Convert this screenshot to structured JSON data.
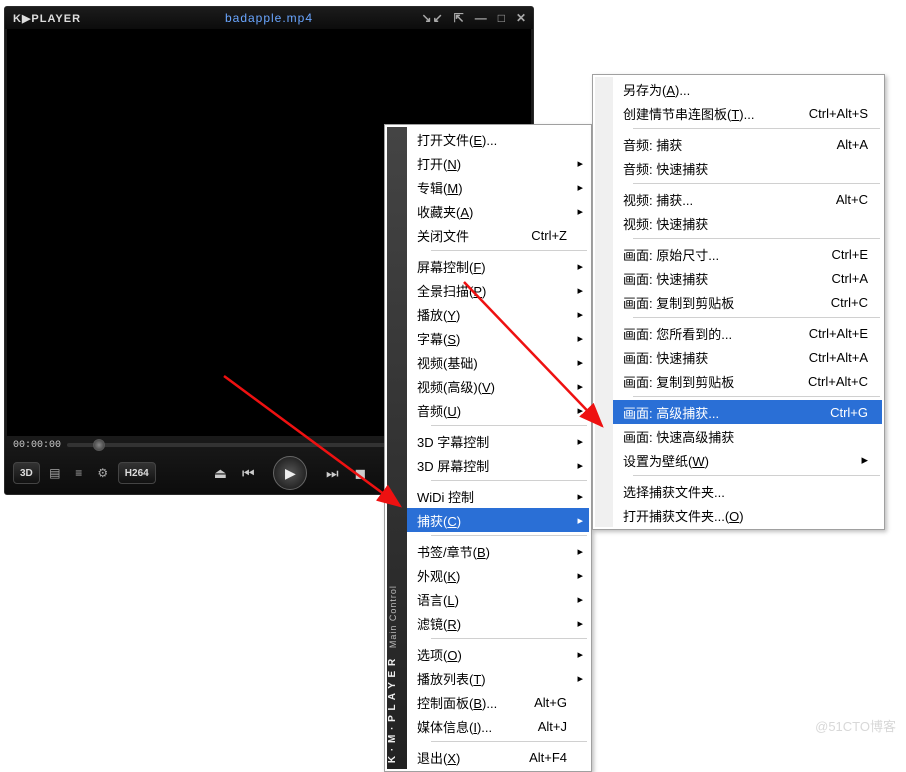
{
  "player": {
    "app_name": "K▶PLAYER",
    "filename": "badapple.mp4",
    "time_display": "00:00:00",
    "badge_3d": "3D",
    "badge_codec": "H264",
    "win_controls": {
      "pin": "↘↙",
      "dock": "⇱",
      "top": "⌂",
      "min": "—",
      "max": "□",
      "close": "✕"
    }
  },
  "menu1": {
    "sidebar_main": "K · M · P L A Y E R",
    "sidebar_sub": "Main Control",
    "items": [
      {
        "label": "打开文件(<u>E</u>)...",
        "arrow": false
      },
      {
        "label": "打开(<u>N</u>)",
        "arrow": true
      },
      {
        "label": "专辑(<u>M</u>)",
        "arrow": true
      },
      {
        "label": "收藏夹(<u>A</u>)",
        "arrow": true
      },
      {
        "label": "关闭文件",
        "shortcut": "Ctrl+Z"
      },
      {
        "sep": true
      },
      {
        "label": "屏幕控制(<u>F</u>)",
        "arrow": true
      },
      {
        "label": "全景扫描(<u>P</u>)",
        "arrow": true
      },
      {
        "label": "播放(<u>Y</u>)",
        "arrow": true
      },
      {
        "label": "字幕(<u>S</u>)",
        "arrow": true
      },
      {
        "label": "视频(基础)",
        "arrow": true
      },
      {
        "label": "视频(高级)(<u>V</u>)",
        "arrow": true
      },
      {
        "label": "音频(<u>U</u>)",
        "arrow": true
      },
      {
        "sep": true
      },
      {
        "label": "3D 字幕控制",
        "arrow": true
      },
      {
        "label": "3D 屏幕控制",
        "arrow": true
      },
      {
        "sep": true
      },
      {
        "label": "WiDi 控制",
        "arrow": true
      },
      {
        "label": "捕获(<u>C</u>)",
        "arrow": true,
        "highlight": true
      },
      {
        "sep": true
      },
      {
        "label": "书签/章节(<u>B</u>)",
        "arrow": true
      },
      {
        "label": "外观(<u>K</u>)",
        "arrow": true
      },
      {
        "label": "语言(<u>L</u>)",
        "arrow": true
      },
      {
        "label": "滤镜(<u>R</u>)",
        "arrow": true
      },
      {
        "sep": true
      },
      {
        "label": "选项(<u>O</u>)",
        "arrow": true
      },
      {
        "label": "播放列表(<u>T</u>)",
        "arrow": true
      },
      {
        "label": "控制面板(<u>B</u>)...",
        "shortcut": "Alt+G"
      },
      {
        "label": "媒体信息(<u>I</u>)...",
        "shortcut": "Alt+J"
      },
      {
        "sep": true
      },
      {
        "label": "退出(<u>X</u>)",
        "shortcut": "Alt+F4"
      }
    ]
  },
  "menu2": {
    "items": [
      {
        "label": "另存为(<u>A</u>)..."
      },
      {
        "label": "创建情节串连图板(<u>T</u>)...",
        "shortcut": "Ctrl+Alt+S"
      },
      {
        "sep": true
      },
      {
        "label": "音频: 捕获",
        "shortcut": "Alt+A"
      },
      {
        "label": "音频: 快速捕获"
      },
      {
        "sep": true
      },
      {
        "label": "视频: 捕获...",
        "shortcut": "Alt+C"
      },
      {
        "label": "视频: 快速捕获"
      },
      {
        "sep": true
      },
      {
        "label": "画面: 原始尺寸...",
        "shortcut": "Ctrl+E"
      },
      {
        "label": "画面: 快速捕获",
        "shortcut": "Ctrl+A"
      },
      {
        "label": "画面: 复制到剪贴板",
        "shortcut": "Ctrl+C"
      },
      {
        "sep": true
      },
      {
        "label": "画面: 您所看到的...",
        "shortcut": "Ctrl+Alt+E"
      },
      {
        "label": "画面: 快速捕获",
        "shortcut": "Ctrl+Alt+A"
      },
      {
        "label": "画面: 复制到剪贴板",
        "shortcut": "Ctrl+Alt+C"
      },
      {
        "sep": true
      },
      {
        "label": "画面: 高级捕获...",
        "shortcut": "Ctrl+G",
        "highlight": true
      },
      {
        "label": "画面: 快速高级捕获"
      },
      {
        "label": "设置为壁纸(<u>W</u>)",
        "arrow": true
      },
      {
        "sep": true
      },
      {
        "label": "选择捕获文件夹..."
      },
      {
        "label": "打开捕获文件夹...(<u>O</u>)"
      }
    ]
  },
  "watermark": "@51CTO博客"
}
